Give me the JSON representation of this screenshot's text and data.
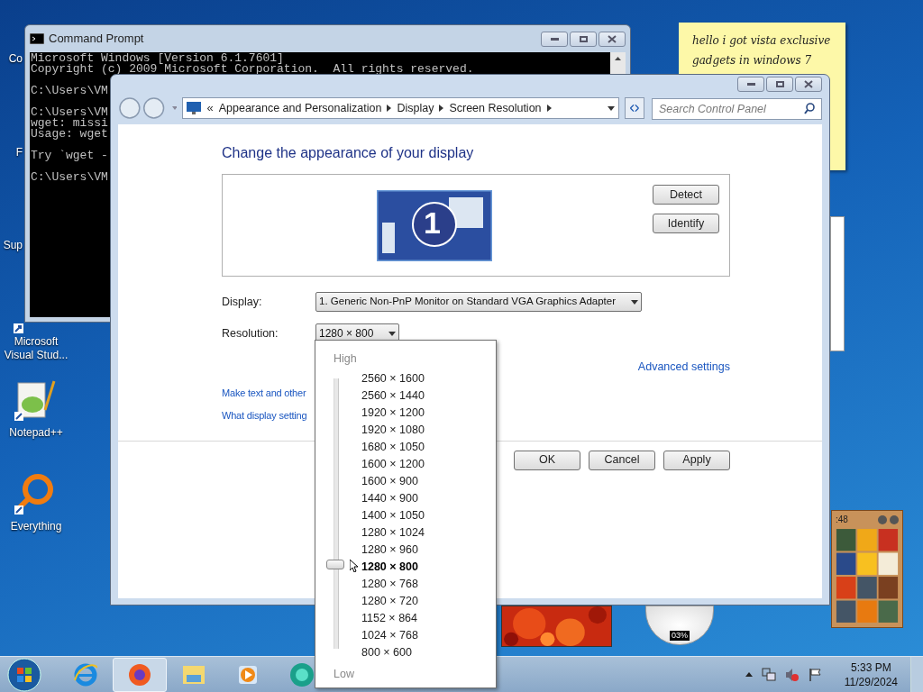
{
  "desktop_icons": [
    {
      "label": "Co",
      "kind": "partial"
    },
    {
      "label": "F",
      "kind": "partial"
    },
    {
      "label": "Sup",
      "kind": "partial"
    },
    {
      "label": "Microsoft Visual Stud...",
      "kind": "app"
    },
    {
      "label": "Notepad++",
      "kind": "notepad"
    },
    {
      "label": "Everything",
      "kind": "search"
    }
  ],
  "command_prompt": {
    "title": "Command Prompt",
    "blocks": [
      [
        "Microsoft Windows [Version 6.1.7601]",
        "Copyright (c) 2009 Microsoft Corporation.  All rights reserved."
      ],
      [
        "C:\\Users\\VM"
      ],
      [
        "C:\\Users\\VM",
        "wget: missi",
        "Usage: wget"
      ],
      [
        "Try `wget -"
      ],
      [
        "C:\\Users\\VM"
      ]
    ]
  },
  "sticky_note": {
    "text": "hello i got vista exclusive gadgets in windows 7"
  },
  "control_panel": {
    "breadcrumb_overflow": "«",
    "breadcrumb": [
      "Appearance and Personalization",
      "Display",
      "Screen Resolution"
    ],
    "search": {
      "placeholder": "Search Control Panel"
    },
    "heading": "Change the appearance of your display",
    "monitor_number": "1",
    "side_buttons": [
      "Detect",
      "Identify"
    ],
    "display": {
      "label": "Display:",
      "value": "1. Generic Non-PnP Monitor on Standard VGA Graphics Adapter"
    },
    "resolution": {
      "label": "Resolution:",
      "value": "1280 × 800"
    },
    "advanced_link": "Advanced settings",
    "links": [
      "Make text and other",
      "What display setting"
    ],
    "buttons": [
      "OK",
      "Cancel",
      "Apply"
    ]
  },
  "resolution_dropdown": {
    "high": "High",
    "low": "Low",
    "level": 0.3125,
    "options": [
      {
        "label": "2560 × 1600",
        "selected": false
      },
      {
        "label": "2560 × 1440",
        "selected": false
      },
      {
        "label": "1920 × 1200",
        "selected": false
      },
      {
        "label": "1920 × 1080",
        "selected": false
      },
      {
        "label": "1680 × 1050",
        "selected": false
      },
      {
        "label": "1600 × 1200",
        "selected": false
      },
      {
        "label": "1600 × 900",
        "selected": false
      },
      {
        "label": "1440 × 900",
        "selected": false
      },
      {
        "label": "1400 × 1050",
        "selected": false
      },
      {
        "label": "1280 × 1024",
        "selected": false
      },
      {
        "label": "1280 × 960",
        "selected": false
      },
      {
        "label": "1280 × 800",
        "selected": true
      },
      {
        "label": "1280 × 768",
        "selected": false
      },
      {
        "label": "1280 × 720",
        "selected": false
      },
      {
        "label": "1152 × 864",
        "selected": false
      },
      {
        "label": "1024 × 768",
        "selected": false
      },
      {
        "label": "800 × 600",
        "selected": false
      }
    ]
  },
  "gadgets": {
    "puzzle_timer": ":48",
    "cpu_meter": "03%"
  },
  "taskbar": {
    "apps": [
      {
        "kind": "ie",
        "selected": false
      },
      {
        "kind": "firefox",
        "selected": true
      },
      {
        "kind": "folder",
        "selected": false
      },
      {
        "kind": "media",
        "selected": false
      },
      {
        "kind": "globe",
        "selected": false
      }
    ],
    "time": "5:33 PM",
    "date": "11/29/2024"
  }
}
